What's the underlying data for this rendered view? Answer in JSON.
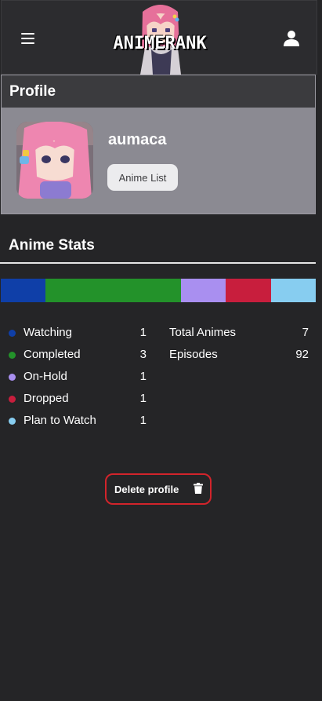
{
  "header": {
    "menu_icon": "hamburger-menu-icon",
    "logo_text": "ANIMERANK",
    "user_icon": "user-icon"
  },
  "profile": {
    "title": "Profile",
    "username": "aumaca",
    "anime_list_label": "Anime List"
  },
  "stats": {
    "title": "Anime Stats",
    "items": [
      {
        "label": "Watching",
        "count": "1",
        "color": "#0f3fa8"
      },
      {
        "label": "Completed",
        "count": "3",
        "color": "#23922a"
      },
      {
        "label": "On-Hold",
        "count": "1",
        "color": "#a98ff0"
      },
      {
        "label": "Dropped",
        "count": "1",
        "color": "#c81e3d"
      },
      {
        "label": "Plan to Watch",
        "count": "1",
        "color": "#87cdf0"
      }
    ],
    "totals": [
      {
        "label": "Total Animes",
        "value": "7"
      },
      {
        "label": "Episodes",
        "value": "92"
      }
    ]
  },
  "actions": {
    "delete_label": "Delete profile",
    "delete_icon": "trash-icon",
    "danger_color": "#d2242b"
  }
}
